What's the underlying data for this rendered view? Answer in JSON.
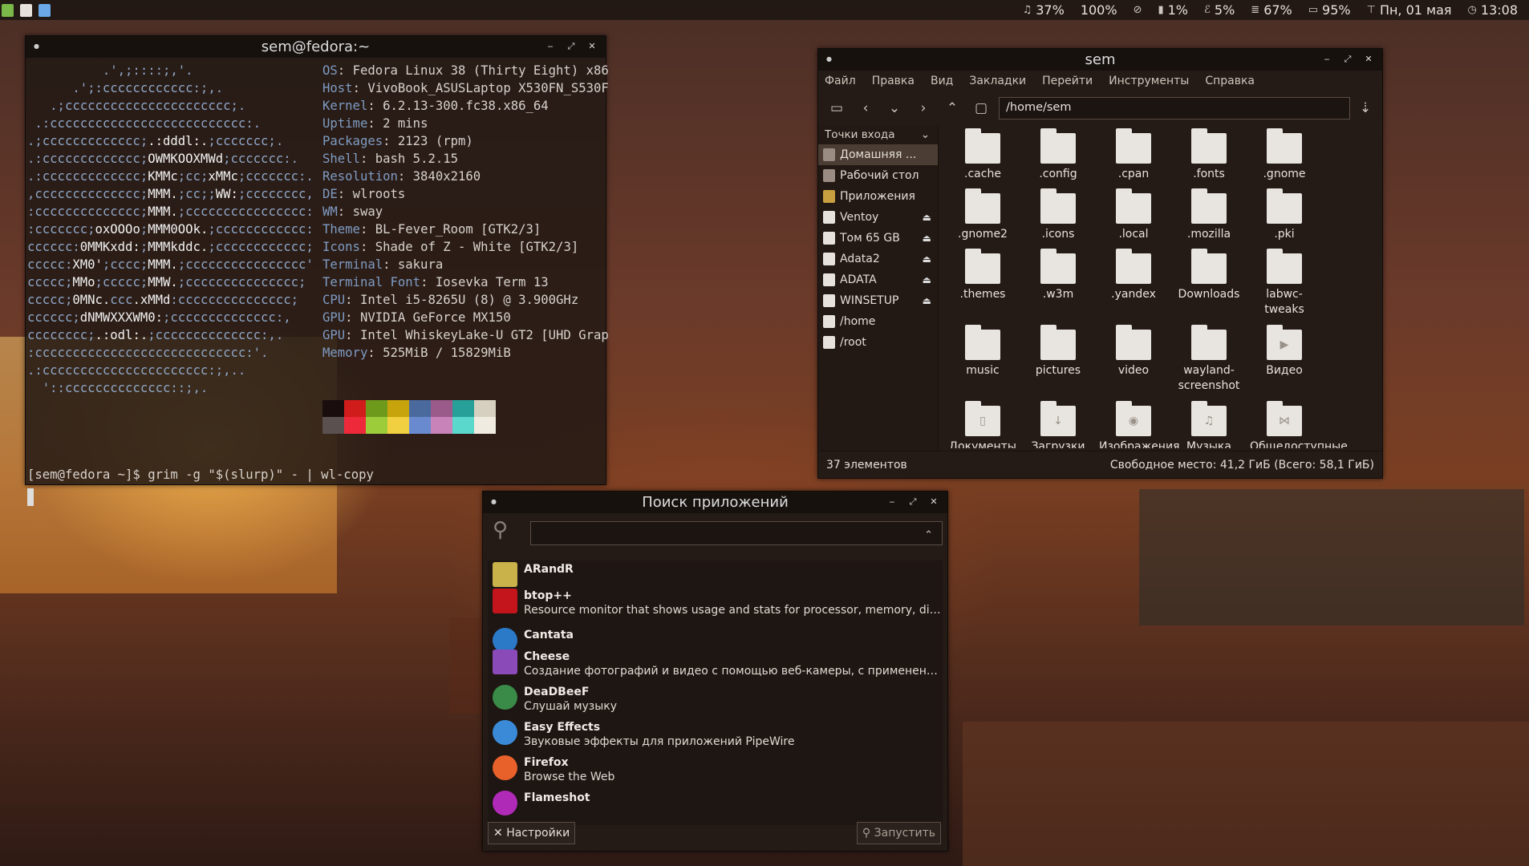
{
  "topbar": {
    "apps": [
      "terminal-icon",
      "text-editor-icon",
      "screenshot-icon"
    ],
    "status": [
      {
        "icon": "headphones-icon",
        "text": "37%"
      },
      {
        "icon": "brightness",
        "text": "100%"
      },
      {
        "icon": "do-not-disturb-icon",
        "text": ""
      },
      {
        "icon": "cpu-icon",
        "text": "1%"
      },
      {
        "icon": "temperature-icon",
        "text": "5%"
      },
      {
        "icon": "memory-icon",
        "text": "67%"
      },
      {
        "icon": "battery-icon",
        "text": "95%"
      },
      {
        "icon": "date-icon",
        "text": "Пн, 01 мая"
      },
      {
        "icon": "clock-icon",
        "text": "13:08"
      }
    ]
  },
  "terminal": {
    "title": "sem@fedora:~",
    "info": [
      {
        "k": "OS",
        "v": "Fedora Linux 38 (Thirty Eight) x86"
      },
      {
        "k": "Host",
        "v": "VivoBook_ASUSLaptop X530FN_S530F"
      },
      {
        "k": "Kernel",
        "v": "6.2.13-300.fc38.x86_64"
      },
      {
        "k": "Uptime",
        "v": "2 mins"
      },
      {
        "k": "Packages",
        "v": "2123 (rpm)"
      },
      {
        "k": "Shell",
        "v": "bash 5.2.15"
      },
      {
        "k": "Resolution",
        "v": "3840x2160"
      },
      {
        "k": "DE",
        "v": "wlroots"
      },
      {
        "k": "WM",
        "v": "sway"
      },
      {
        "k": "Theme",
        "v": "BL-Fever_Room [GTK2/3]"
      },
      {
        "k": "Icons",
        "v": "Shade of Z - White [GTK2/3]"
      },
      {
        "k": "Terminal",
        "v": "sakura"
      },
      {
        "k": "Terminal Font",
        "v": "Iosevka Term 13"
      },
      {
        "k": "CPU",
        "v": "Intel i5-8265U (8) @ 3.900GHz"
      },
      {
        "k": "GPU",
        "v": "NVIDIA GeForce MX150"
      },
      {
        "k": "GPU",
        "v": "Intel WhiskeyLake-U GT2 [UHD Grap"
      },
      {
        "k": "Memory",
        "v": "525MiB / 15829MiB"
      }
    ],
    "palette": [
      "#1a0d0d",
      "#d11c1c",
      "#6e9a1c",
      "#c7a40c",
      "#4a6a9e",
      "#9a5a8a",
      "#28a09a",
      "#d6d0c0",
      "#5a5050",
      "#ee2a3a",
      "#9ccc3a",
      "#f0d040",
      "#6a8ad0",
      "#c884b8",
      "#5ad8cc",
      "#f0ebe0"
    ],
    "prompt": "[sem@fedora ~]$ grim -g \"$(slurp)\" - | wl-copy"
  },
  "filemanager": {
    "title": "sem",
    "menu": [
      "Файл",
      "Правка",
      "Вид",
      "Закладки",
      "Перейти",
      "Инструменты",
      "Справка"
    ],
    "path": "/home/sem",
    "sidebar_header": "Точки входа",
    "places": [
      {
        "label": "Домашняя ...",
        "eject": false
      },
      {
        "label": "Рабочий стол",
        "eject": false
      },
      {
        "label": "Приложения",
        "eject": false
      },
      {
        "label": "Ventoy",
        "eject": true
      },
      {
        "label": "Том 65 GB",
        "eject": true
      },
      {
        "label": "Adata2",
        "eject": true
      },
      {
        "label": "ADATA",
        "eject": true
      },
      {
        "label": "WINSETUP",
        "eject": true
      },
      {
        "label": "/home",
        "eject": false
      },
      {
        "label": "/root",
        "eject": false
      }
    ],
    "files": [
      ".cache",
      ".config",
      ".cpan",
      ".fonts",
      ".gnome",
      ".gnome2",
      ".icons",
      ".local",
      ".mozilla",
      ".pki",
      ".themes",
      ".w3m",
      ".yandex",
      "Downloads",
      "labwc-tweaks",
      "music",
      "pictures",
      "video",
      "wayland-screenshot",
      "Видео",
      "Документы",
      "Загрузки",
      "Изображения",
      "Музыка",
      "Общедоступные"
    ],
    "file_glyphs": {
      "Видео": "▶",
      "Документы": "▯",
      "Загрузки": "↓",
      "Изображения": "◉",
      "Музыка": "♫",
      "Общедоступные": "⋈"
    },
    "count": "37 элементов",
    "free": "Свободное место: 41,2 ГиБ (Всего: 58,1 ГиБ)"
  },
  "appsearch": {
    "title": "Поиск приложений",
    "query": "",
    "apps": [
      {
        "name": "ARandR",
        "desc": "",
        "color": "#c9b24a",
        "icon": "arandr-icon"
      },
      {
        "name": "btop++",
        "desc": "Resource monitor that shows usage and stats for processor, memory, disks, n...",
        "color": "#c4141c",
        "icon": "btop-icon"
      },
      {
        "name": "Cantata",
        "desc": "",
        "color": "#2a7ac8",
        "icon": "cantata-icon"
      },
      {
        "name": "Cheese",
        "desc": "Создание фотографий и видео с помощью веб-камеры, с применением зан...",
        "color": "#8a4ab8",
        "icon": "cheese-icon"
      },
      {
        "name": "DeaDBeeF",
        "desc": "Слушай музыку",
        "color": "#3a8a48",
        "icon": "deadbeef-icon"
      },
      {
        "name": "Easy Effects",
        "desc": "Звуковые эффекты для приложений PipeWire",
        "color": "#3a8ad8",
        "icon": "easyeffects-icon"
      },
      {
        "name": "Firefox",
        "desc": "Browse the Web",
        "color": "#e8602a",
        "icon": "firefox-icon"
      },
      {
        "name": "Flameshot",
        "desc": "",
        "color": "#b02ab8",
        "icon": "flameshot-icon"
      }
    ],
    "settings": "Настройки",
    "launch": "Запустить"
  }
}
